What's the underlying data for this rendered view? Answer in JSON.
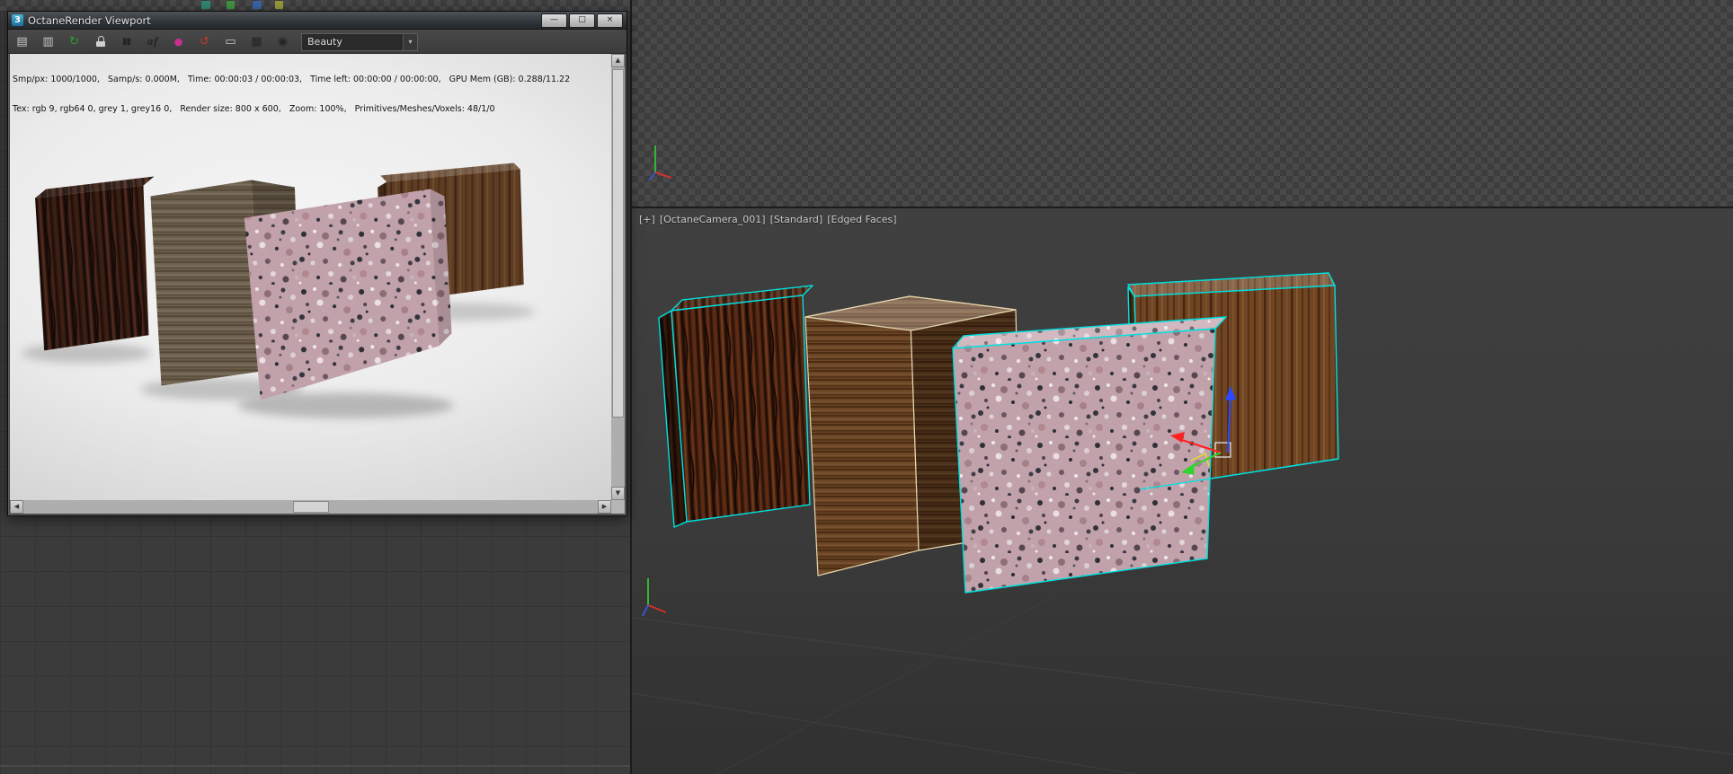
{
  "colors": {
    "selection": "#00e0e0",
    "edged_faces": "#e6d7ae",
    "gizmo_x": "#ff2020",
    "gizmo_y": "#2ed42e",
    "gizmo_z": "#2a48ff",
    "gizmo_plane": "#e0e020",
    "checker_light": "#494949",
    "checker_dark": "#3d3d3d"
  },
  "octane_window": {
    "app_icon_text": "3",
    "title": "OctaneRender Viewport",
    "controls": {
      "minimize": "—",
      "maximize": "□",
      "close": "×"
    },
    "toolbar": {
      "icons": [
        {
          "name": "save-image-icon",
          "glyph": "▤"
        },
        {
          "name": "copy-to-clipboard-icon",
          "glyph": "▥"
        },
        {
          "name": "restart-render-icon",
          "glyph": "↻"
        },
        {
          "name": "lock-viewport-icon",
          "glyph": "",
          "shape": "padlock"
        },
        {
          "name": "pause-render-icon",
          "glyph": "▮▮"
        },
        {
          "name": "subsampling-icon",
          "glyph": "af"
        },
        {
          "name": "focus-picker-icon",
          "glyph": "●"
        },
        {
          "name": "reset-view-icon",
          "glyph": "↺"
        },
        {
          "name": "viewport-display-icon",
          "glyph": "▭"
        },
        {
          "name": "render-passes-icon",
          "glyph": "▦"
        },
        {
          "name": "camera-icon",
          "glyph": "◉"
        }
      ],
      "render_pass_selector": {
        "value": "Beauty",
        "arrow": "▾"
      }
    },
    "stats": {
      "line1": "Smp/px: 1000/1000,   Samp/s: 0.000M,   Time: 00:00:03 / 00:00:03,   Time left: 00:00:00 / 00:00:00,   GPU Mem (GB): 0.288/11.22",
      "line2": "Tex: rgb 9, rgb64 0, grey 1, grey16 0,   Render size: 800 x 600,   Zoom: 100%,   Primitives/Meshes/Voxels: 48/1/0"
    },
    "scrollbar": {
      "up": "▲",
      "down": "▼",
      "left": "◀",
      "right": "▶"
    }
  },
  "camera_viewport": {
    "label": {
      "general_menu": "[+]",
      "pov": "[OctaneCamera_001]",
      "render_preset": "[Standard]",
      "shading": "[Edged Faces]"
    }
  }
}
